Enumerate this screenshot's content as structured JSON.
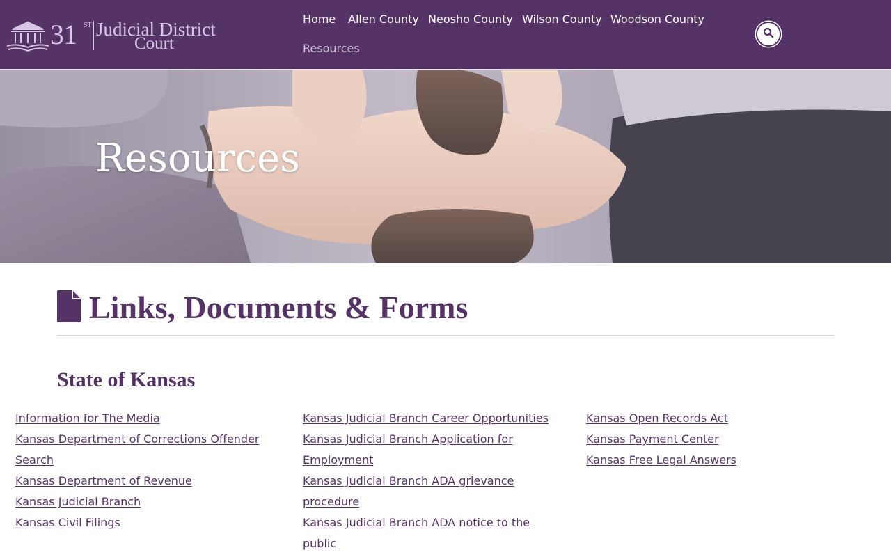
{
  "brand": {
    "number": "31",
    "superscript": "ST",
    "line1": "Judicial District",
    "line2": "Court"
  },
  "nav": {
    "items": [
      {
        "label": "Home"
      },
      {
        "label": "Allen County"
      },
      {
        "label": "Neosho County"
      },
      {
        "label": "Wilson County"
      },
      {
        "label": "Woodson County"
      },
      {
        "label": "Resources",
        "active": true
      }
    ],
    "search_icon": "search-icon"
  },
  "hero": {
    "title": "Resources"
  },
  "content": {
    "section_icon": "file-icon",
    "section_title": "Links, Documents & Forms",
    "subsection_title": "State of Kansas",
    "columns": [
      [
        "Information for The Media",
        "Kansas Department of Corrections Offender Search",
        "Kansas Department of Revenue",
        "Kansas Judicial Branch",
        "Kansas Civil Filings"
      ],
      [
        "Kansas Judicial Branch Career Opportunities",
        "Kansas Judicial Branch Application for Employment",
        "Kansas Judicial Branch ADA grievance procedure",
        "Kansas Judicial Branch ADA notice to the public"
      ],
      [
        "Kansas Open Records Act",
        "Kansas Payment Center",
        "Kansas Free Legal Answers"
      ]
    ]
  },
  "colors": {
    "brand_purple": "#553366",
    "nav_active": "#d0bedc",
    "logo_tint": "#d9c6e6"
  }
}
